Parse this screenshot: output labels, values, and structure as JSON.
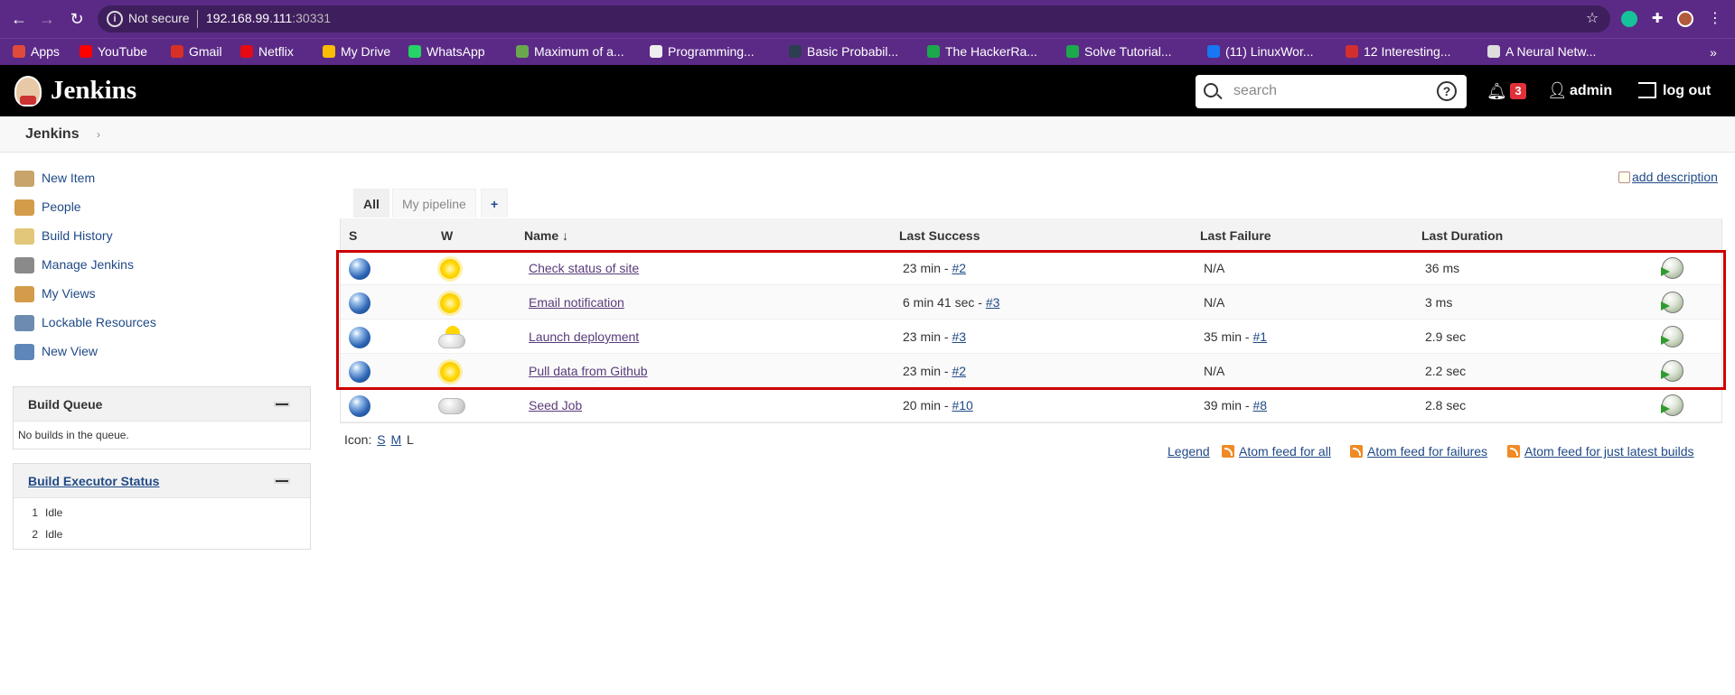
{
  "browser": {
    "security": "Not secure",
    "url_host": "192.168.99.111",
    "url_port": ":30331",
    "bookmarks": [
      {
        "label": "Apps",
        "color": "#e04a3a"
      },
      {
        "label": "YouTube",
        "color": "#ff0000"
      },
      {
        "label": "Gmail",
        "color": "#d93025"
      },
      {
        "label": "Netflix",
        "color": "#e50914"
      },
      {
        "label": "My Drive",
        "color": "#fbbc04"
      },
      {
        "label": "WhatsApp",
        "color": "#25d366"
      },
      {
        "label": "Maximum of a...",
        "color": "#6aa84f"
      },
      {
        "label": "Programming...",
        "color": "#eeeeee"
      },
      {
        "label": "Basic Probabil...",
        "color": "#2c3e50"
      },
      {
        "label": "The HackerRa...",
        "color": "#1ba94c"
      },
      {
        "label": "Solve Tutorial...",
        "color": "#1ba94c"
      },
      {
        "label": "(11) LinuxWor...",
        "color": "#1877f2"
      },
      {
        "label": "12 Interesting...",
        "color": "#d32f2f"
      },
      {
        "label": "A Neural Netw...",
        "color": "#dddddd"
      }
    ]
  },
  "header": {
    "title": "Jenkins",
    "search_placeholder": "search",
    "help": "?",
    "notifications": "3",
    "user": "admin",
    "logout": "log out"
  },
  "breadcrumb": {
    "root": "Jenkins",
    "chevron": "›"
  },
  "sidebar": {
    "tasks": [
      {
        "label": "New Item",
        "icon": "folder-new-icon",
        "color": "#c8a46a"
      },
      {
        "label": "People",
        "icon": "people-icon",
        "color": "#d39b4a"
      },
      {
        "label": "Build History",
        "icon": "notepad-icon",
        "color": "#e2c77a"
      },
      {
        "label": "Manage Jenkins",
        "icon": "gear-icon",
        "color": "#8a8a8a"
      },
      {
        "label": "My Views",
        "icon": "people-icon",
        "color": "#d39b4a"
      },
      {
        "label": "Lockable Resources",
        "icon": "lock-icon",
        "color": "#6d8bb0"
      },
      {
        "label": "New View",
        "icon": "folder-icon",
        "color": "#5f86b8"
      }
    ],
    "build_queue": {
      "title": "Build Queue",
      "empty": "No builds in the queue."
    },
    "executors": {
      "title": "Build Executor Status",
      "rows": [
        {
          "num": "1",
          "state": "Idle"
        },
        {
          "num": "2",
          "state": "Idle"
        }
      ]
    }
  },
  "main": {
    "add_description": "add description",
    "tabs": [
      {
        "label": "All"
      },
      {
        "label": "My pipeline"
      },
      {
        "label": "+"
      }
    ],
    "columns": {
      "s": "S",
      "w": "W",
      "name": "Name",
      "sort": "↓",
      "last_success": "Last Success",
      "last_failure": "Last Failure",
      "last_duration": "Last Duration"
    },
    "jobs": [
      {
        "name": "Check status of site",
        "weather": "sunny",
        "succ_time": "23 min - ",
        "succ_build": "#2",
        "fail_time": "N/A",
        "fail_build": "",
        "duration": "36 ms"
      },
      {
        "name": "Email notification",
        "weather": "sunny",
        "succ_time": "6 min 41 sec - ",
        "succ_build": "#3",
        "fail_time": "N/A",
        "fail_build": "",
        "duration": "3 ms"
      },
      {
        "name": "Launch deployment",
        "weather": "partly-cloudy",
        "succ_time": "23 min - ",
        "succ_build": "#3",
        "fail_time": "35 min - ",
        "fail_build": "#1",
        "duration": "2.9 sec"
      },
      {
        "name": "Pull data from Github",
        "weather": "sunny",
        "succ_time": "23 min - ",
        "succ_build": "#2",
        "fail_time": "N/A",
        "fail_build": "",
        "duration": "2.2 sec"
      },
      {
        "name": "Seed Job",
        "weather": "cloudy",
        "succ_time": "20 min - ",
        "succ_build": "#10",
        "fail_time": "39 min - ",
        "fail_build": "#8",
        "duration": "2.8 sec"
      }
    ],
    "icon_label": "Icon:",
    "icon_sizes": [
      "S",
      "M",
      "L"
    ],
    "footer_links": {
      "legend": "Legend",
      "feed_all": "Atom feed for all",
      "feed_failures": "Atom feed for failures",
      "feed_latest": "Atom feed for just latest builds"
    }
  },
  "colors": {
    "highlight": "#cc0000",
    "link": "#204a87",
    "visited": "#5a3b7a",
    "header_bg": "#000000",
    "chrome": "#5b2a86"
  }
}
